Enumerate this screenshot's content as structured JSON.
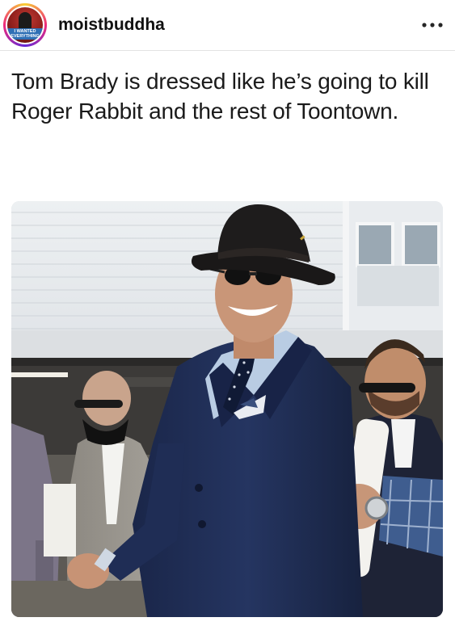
{
  "post": {
    "username": "moistbuddha",
    "avatar_text": "I WANTED EVERYTHING",
    "caption": "Tom Brady is dressed like he’s going to kill Roger Rabbit and the rest of Toontown.",
    "more_icon": "more-horizontal-icon"
  },
  "colors": {
    "suit": "#1f2d55",
    "hat": "#1c1a1a",
    "building": "#e6e9ec",
    "avatar_ring": "#ee2a7b"
  }
}
